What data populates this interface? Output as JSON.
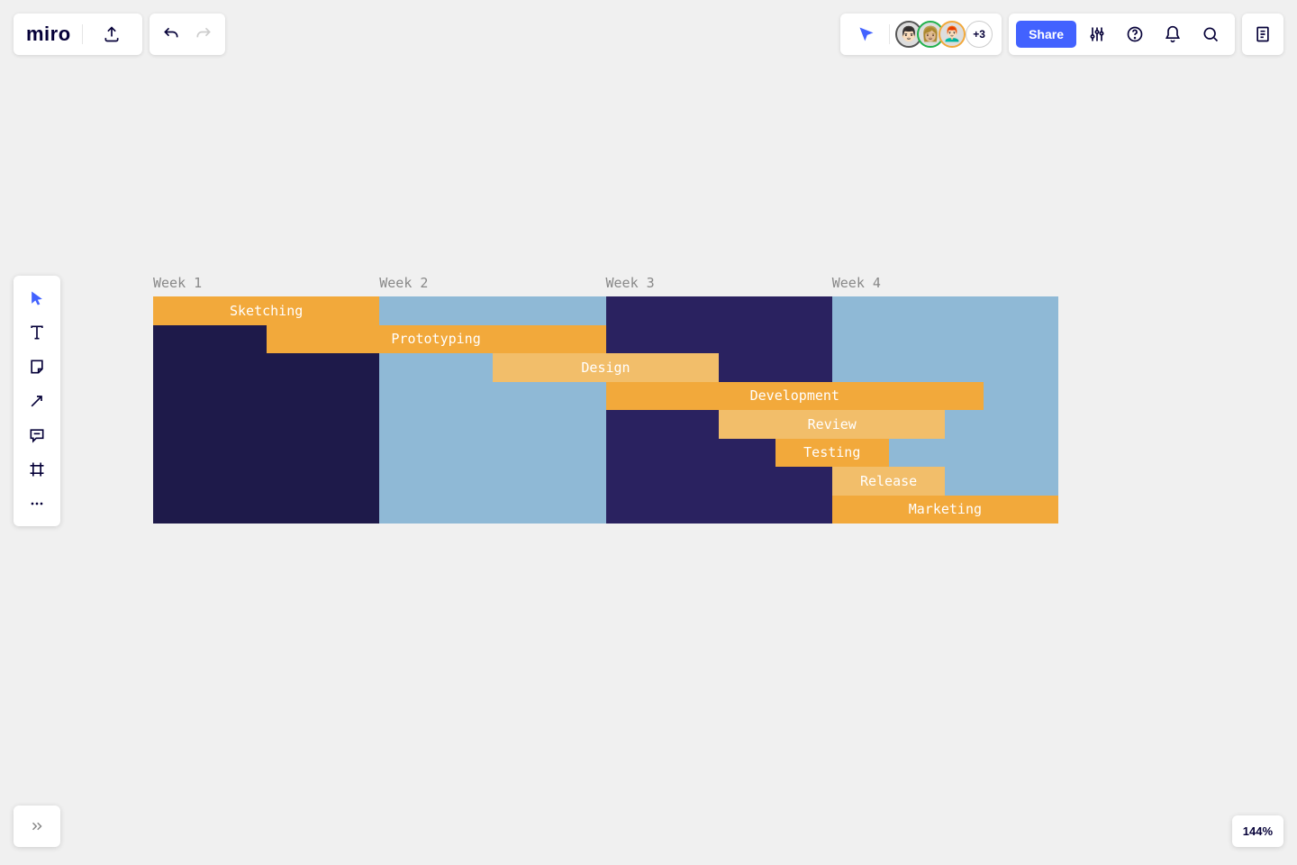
{
  "app": {
    "logo": "miro"
  },
  "collab": {
    "overflow_count": "+3",
    "share_label": "Share",
    "avatars": [
      {
        "emoji": "👨🏻",
        "ring": "#555"
      },
      {
        "emoji": "👩🏼",
        "ring": "#22b14c"
      },
      {
        "emoji": "👨🏻‍🦰",
        "ring": "#f2a93b"
      }
    ]
  },
  "zoom": {
    "level": "144%"
  },
  "gantt": {
    "weeks": [
      "Week 1",
      "Week 2",
      "Week 3",
      "Week 4"
    ],
    "row_bg_colors": [
      "dark1",
      "light",
      "dark2",
      "light"
    ],
    "tasks": [
      {
        "label": "Sketching",
        "start": 0,
        "span": 1,
        "variant": "solid"
      },
      {
        "label": "Prototyping",
        "start": 0.5,
        "span": 1.5,
        "variant": "solid"
      },
      {
        "label": "Design",
        "start": 1.5,
        "span": 1,
        "variant": "fade"
      },
      {
        "label": "Development",
        "start": 2,
        "span": 1.67,
        "variant": "solid"
      },
      {
        "label": "Review",
        "start": 2.5,
        "span": 1,
        "variant": "fade"
      },
      {
        "label": "Testing",
        "start": 2.75,
        "span": 0.5,
        "variant": "solid"
      },
      {
        "label": "Release",
        "start": 3,
        "span": 0.5,
        "variant": "fade"
      },
      {
        "label": "Marketing",
        "start": 3,
        "span": 1,
        "variant": "solid"
      }
    ]
  }
}
